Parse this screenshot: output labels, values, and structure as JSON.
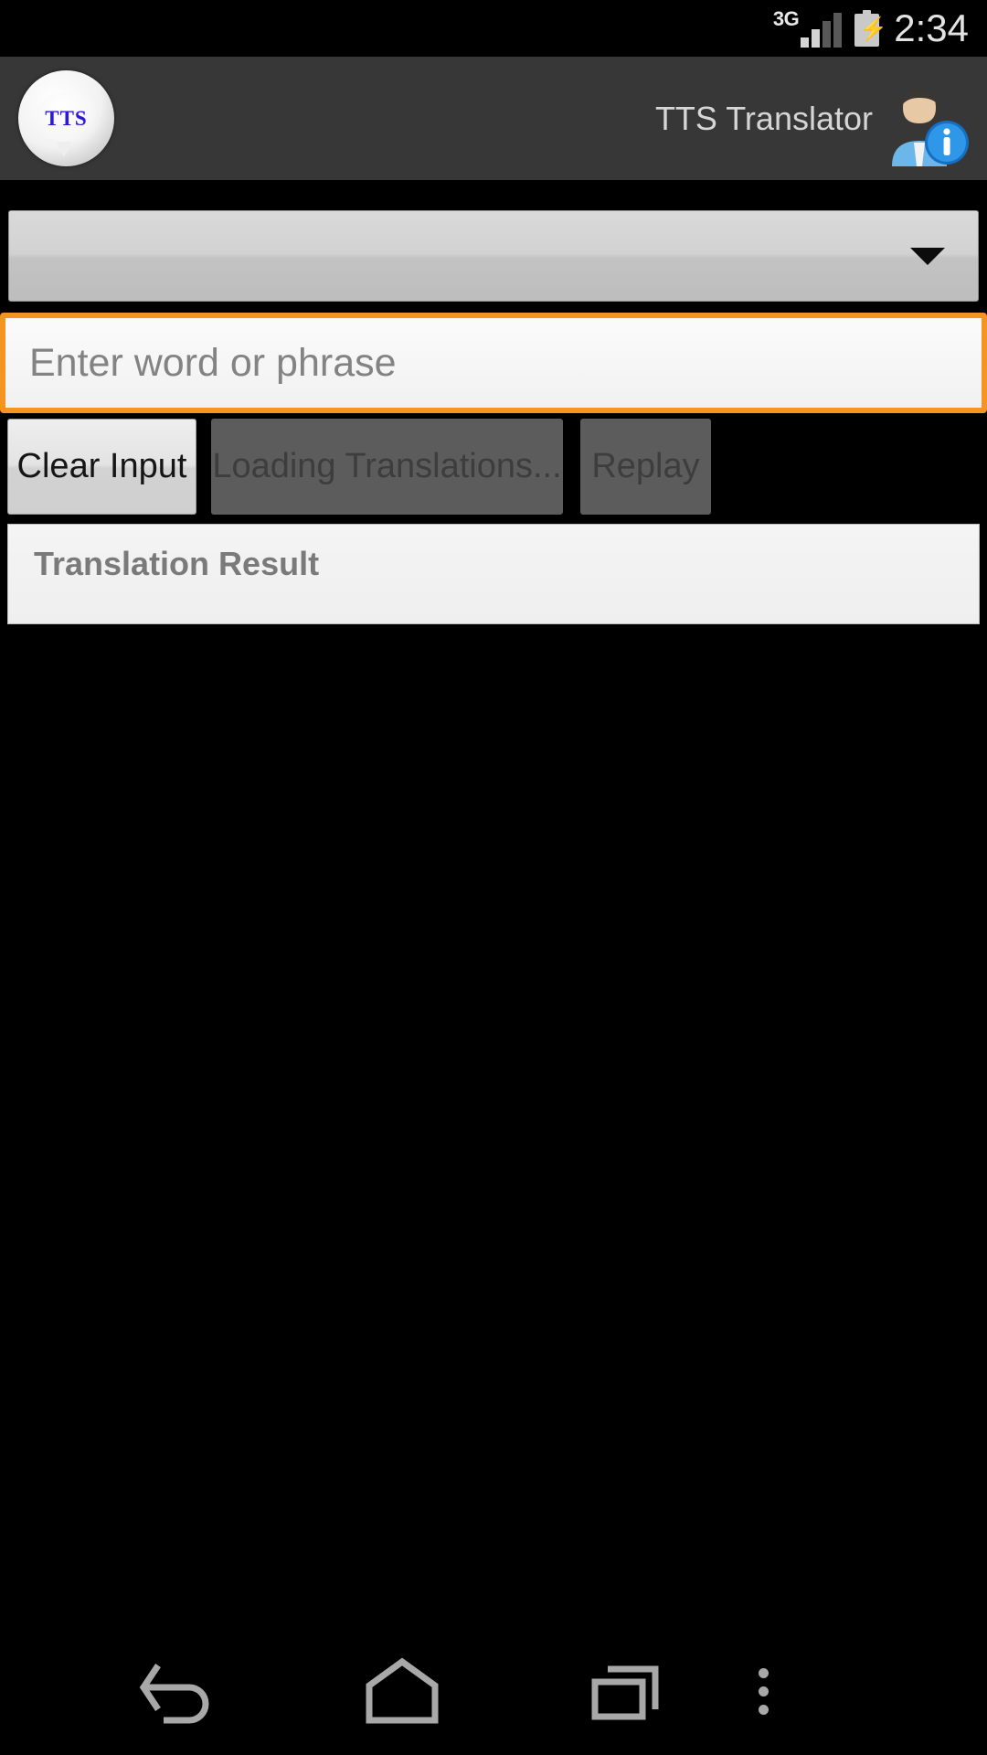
{
  "status_bar": {
    "network_type": "3G",
    "signal_bars_total": 4,
    "signal_bars_active": 2,
    "battery_state": "charging",
    "battery_glyph": "⚡",
    "time": "2:34"
  },
  "action_bar": {
    "logo_text": "TTS",
    "title": "TTS Translator",
    "avatar_icon": "user-info-icon",
    "background_color": "#373737"
  },
  "language_spinner": {
    "selected_value": "",
    "caret_icon": "chevron-down-icon"
  },
  "text_input": {
    "value": "",
    "placeholder": "Enter word or phrase",
    "focus_border_color": "#f59323",
    "focused": true
  },
  "buttons": [
    {
      "id": "clear-input",
      "label": "Clear Input",
      "enabled": true
    },
    {
      "id": "translate",
      "label": "Loading Translations...",
      "enabled": false
    },
    {
      "id": "replay",
      "label": "Replay",
      "enabled": false
    }
  ],
  "result_panel": {
    "label": "Translation Result",
    "text": ""
  },
  "nav_bar": {
    "back_icon": "back-arrow-icon",
    "home_icon": "home-icon",
    "recents_icon": "recents-icon",
    "menu_icon": "overflow-menu-icon"
  }
}
